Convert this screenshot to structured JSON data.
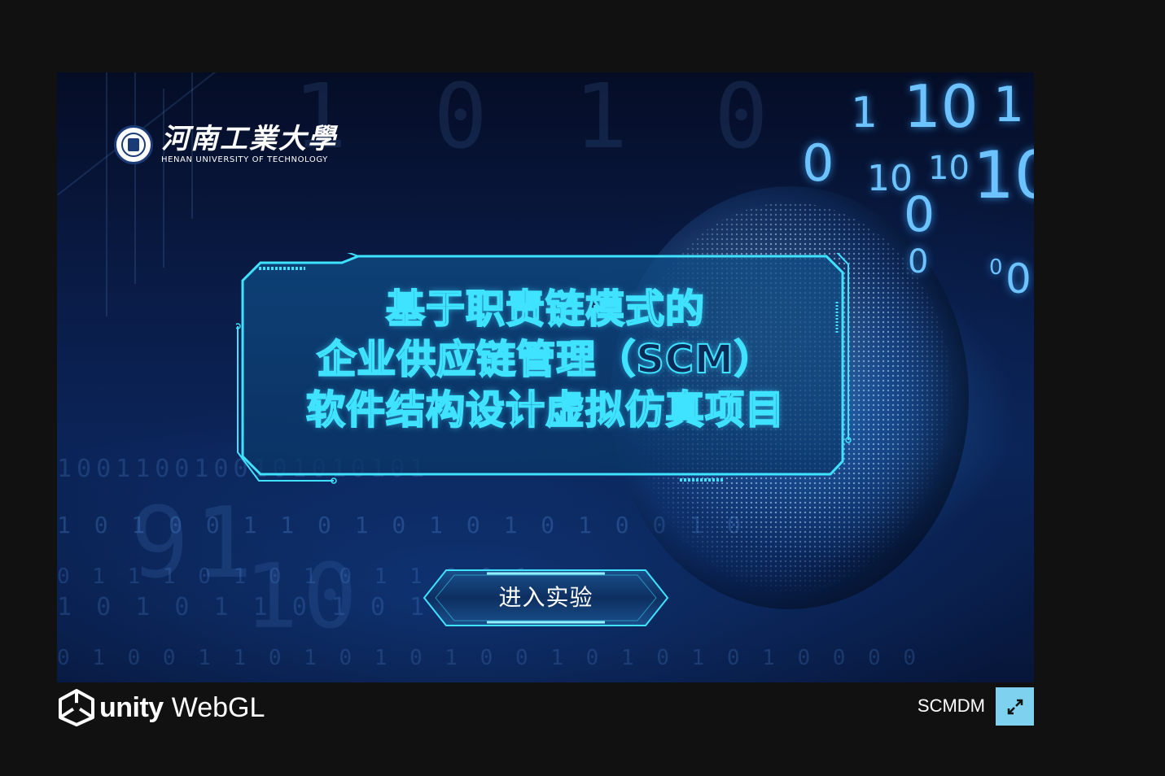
{
  "logo": {
    "chinese_name": "河南工業大學",
    "english_name": "HENAN UNIVERSITY OF TECHNOLOGY"
  },
  "title": {
    "lines": [
      "基于职责链模式的",
      "企业供应链管理（SCM）",
      "软件结构设计虚拟仿真项目"
    ]
  },
  "enter_button": {
    "label": "进入实验"
  },
  "footer": {
    "unity_label": "unity",
    "webgl_label": "WebGL",
    "build_title": "SCMDM",
    "fullscreen_icon": "expand-arrows-icon"
  },
  "background": {
    "binary_rows": [
      "1001100100101010101",
      "1 0 1 0 0 1 1 0 1 0 1 0 1 0 1 0 0 1 0",
      "0 1 1 1 0 1 0 1 0 1 1 0 0 1",
      "1 0 1 0 1 1 0 1 0 1 1",
      "0 1 0 0 1 1 0 1 0 1 0 1 0 0 1 0 1 0 1 0 1 0 0 0 0"
    ]
  },
  "colors": {
    "page_bg": "#111111",
    "accent_cyan": "#3fe2ff",
    "fullscreen_bg": "#7fd2ef"
  }
}
